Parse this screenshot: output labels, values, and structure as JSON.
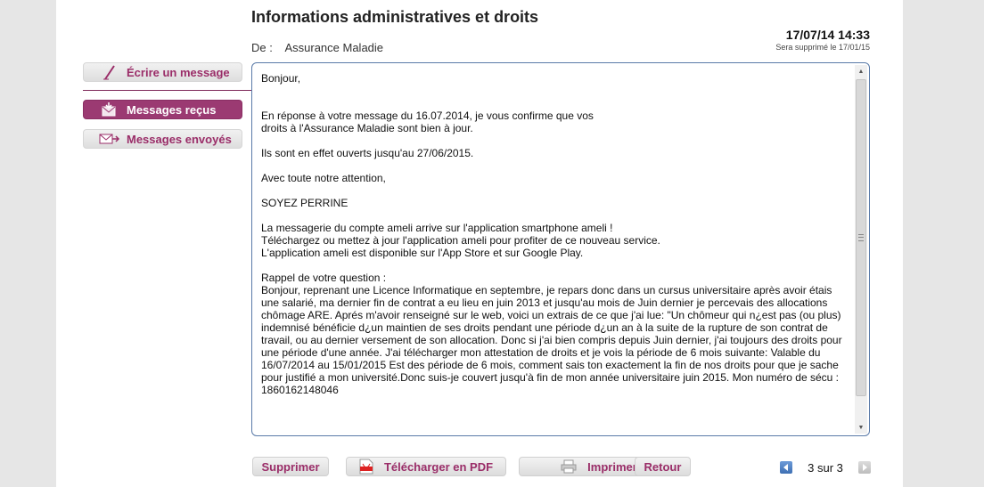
{
  "header": {
    "title": "Informations administratives et droits",
    "from_label": "De :",
    "from_value": "Assurance Maladie",
    "datetime": "17/07/14 14:33",
    "deletion_note": "Sera supprimé le 17/01/15"
  },
  "sidebar": {
    "write_label": "Écrire un message",
    "received_label": "Messages reçus",
    "sent_label": "Messages envoyés"
  },
  "message": {
    "paragraphs": [
      "Bonjour,",
      "\nEn réponse à votre message du 16.07.2014, je vous confirme que vos\ndroits à l'Assurance Maladie sont bien à jour.",
      "Ils sont en effet ouverts jusqu'au 27/06/2015.",
      "Avec toute notre attention,",
      "SOYEZ PERRINE",
      "La messagerie du compte ameli arrive sur l'application smartphone ameli !\nTéléchargez ou mettez à jour l'application ameli  pour profiter de ce nouveau service.\nL'application ameli est disponible sur l'App Store et sur Google Play.",
      "Rappel de votre question :\nBonjour, reprenant une Licence Informatique en septembre, je repars donc dans un cursus universitaire après avoir étais une salarié, ma dernier fin de contrat a eu lieu en juin 2013 et jusqu'au mois de Juin dernier je percevais des allocations chômage ARE. Aprés m'avoir renseigné sur le web, voici un extrais de ce que j'ai lue: \"Un chômeur qui n¿est pas (ou plus) indemnisé bénéficie d¿un maintien de ses droits pendant une période d¿un an à la suite de la rupture de son contrat de travail, ou au dernier versement de son allocation. Donc si j'ai bien compris depuis Juin dernier, j'ai toujours des droits pour une période d'une année. J'ai télécharger mon attestation de droits et je vois la période de 6 mois suivante: Valable du 16/07/2014 au 15/01/2015 Est des période de 6 mois, comment sais ton exactement la fin de nos droits pour que je sache pour justifié a mon université.Donc suis-je couvert jusqu'à fin de mon année universitaire juin 2015. Mon numéro de sécu : 1860162148046"
    ]
  },
  "actions": {
    "delete_label": "Supprimer",
    "pdf_label": "Télécharger en PDF",
    "print_label": "Imprimer",
    "back_label": "Retour"
  },
  "pager": {
    "text": "3 sur 3"
  },
  "colors": {
    "accent": "#9b3a72",
    "border_blue": "#5a7aa8"
  }
}
